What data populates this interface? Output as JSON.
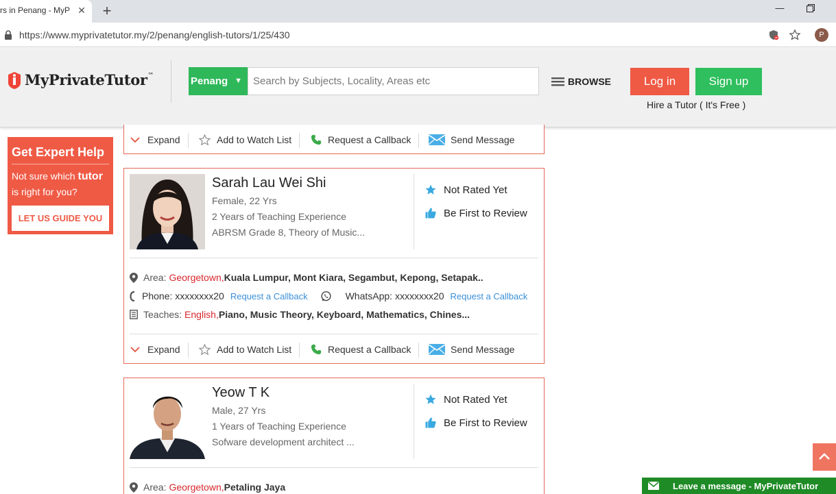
{
  "browser": {
    "tab_title": "rs in Penang - MyP",
    "new_tab": "+",
    "url": "https://www.myprivatetutor.my/2/penang/english-tutors/1/25/430",
    "profile_initial": "P"
  },
  "header": {
    "logo_text": "MyPrivateTutor",
    "logo_tm": "™",
    "city": "Penang",
    "search_placeholder": "Search by Subjects, Locality, Areas etc",
    "browse_label": "BROWSE",
    "login_label": "Log in",
    "signup_label": "Sign up",
    "hire_label": "Hire a Tutor ( It's Free )"
  },
  "sidebar": {
    "title": "Get Expert Help",
    "text_before": "Not sure which ",
    "text_bold": "tutor",
    "text_after": " is right for you?",
    "button_label": "LET US GUIDE YOU"
  },
  "actions": {
    "expand": "Expand",
    "watch": "Add to Watch List",
    "callback": "Request a Callback",
    "message": "Send Message"
  },
  "tutors": [
    {
      "name": "Sarah Lau Wei Shi",
      "gender_age": "Female, 22 Yrs",
      "experience": "2 Years of Teaching Experience",
      "qualification": "ABRSM Grade 8, Theory of Music...",
      "rating": "Not Rated Yet",
      "review": "Be First to Review",
      "area_label": "Area:",
      "area_highlight": "Georgetown,",
      "area_rest": " Kuala Lumpur, Mont Kiara, Segambut, Kepong, Setapak..",
      "phone": "Phone: xxxxxxxx20",
      "phone_link": "Request a Callback",
      "whatsapp": "WhatsApp: xxxxxxxx20",
      "whatsapp_link": "Request a Callback",
      "teaches_label": "Teaches:",
      "teaches_highlight": "English,",
      "teaches_rest": " Piano, Music Theory, Keyboard, Mathematics, Chines..."
    },
    {
      "name": "Yeow T K",
      "gender_age": "Male, 27 Yrs",
      "experience": "1 Years of Teaching Experience",
      "qualification": "Sofware development architect ...",
      "rating": "Not Rated Yet",
      "review": "Be First to Review",
      "area_label": "Area:",
      "area_highlight": "Georgetown,",
      "area_rest": " Petaling Jaya"
    }
  ],
  "chat": {
    "label": "Leave a message - MyPrivateTutor"
  },
  "colors": {
    "brand_red": "#ef5a45",
    "brand_green": "#2fb85a",
    "highlight_red": "#d9262c",
    "link_blue": "#3a8fd9",
    "chat_green": "#1f8b26"
  }
}
